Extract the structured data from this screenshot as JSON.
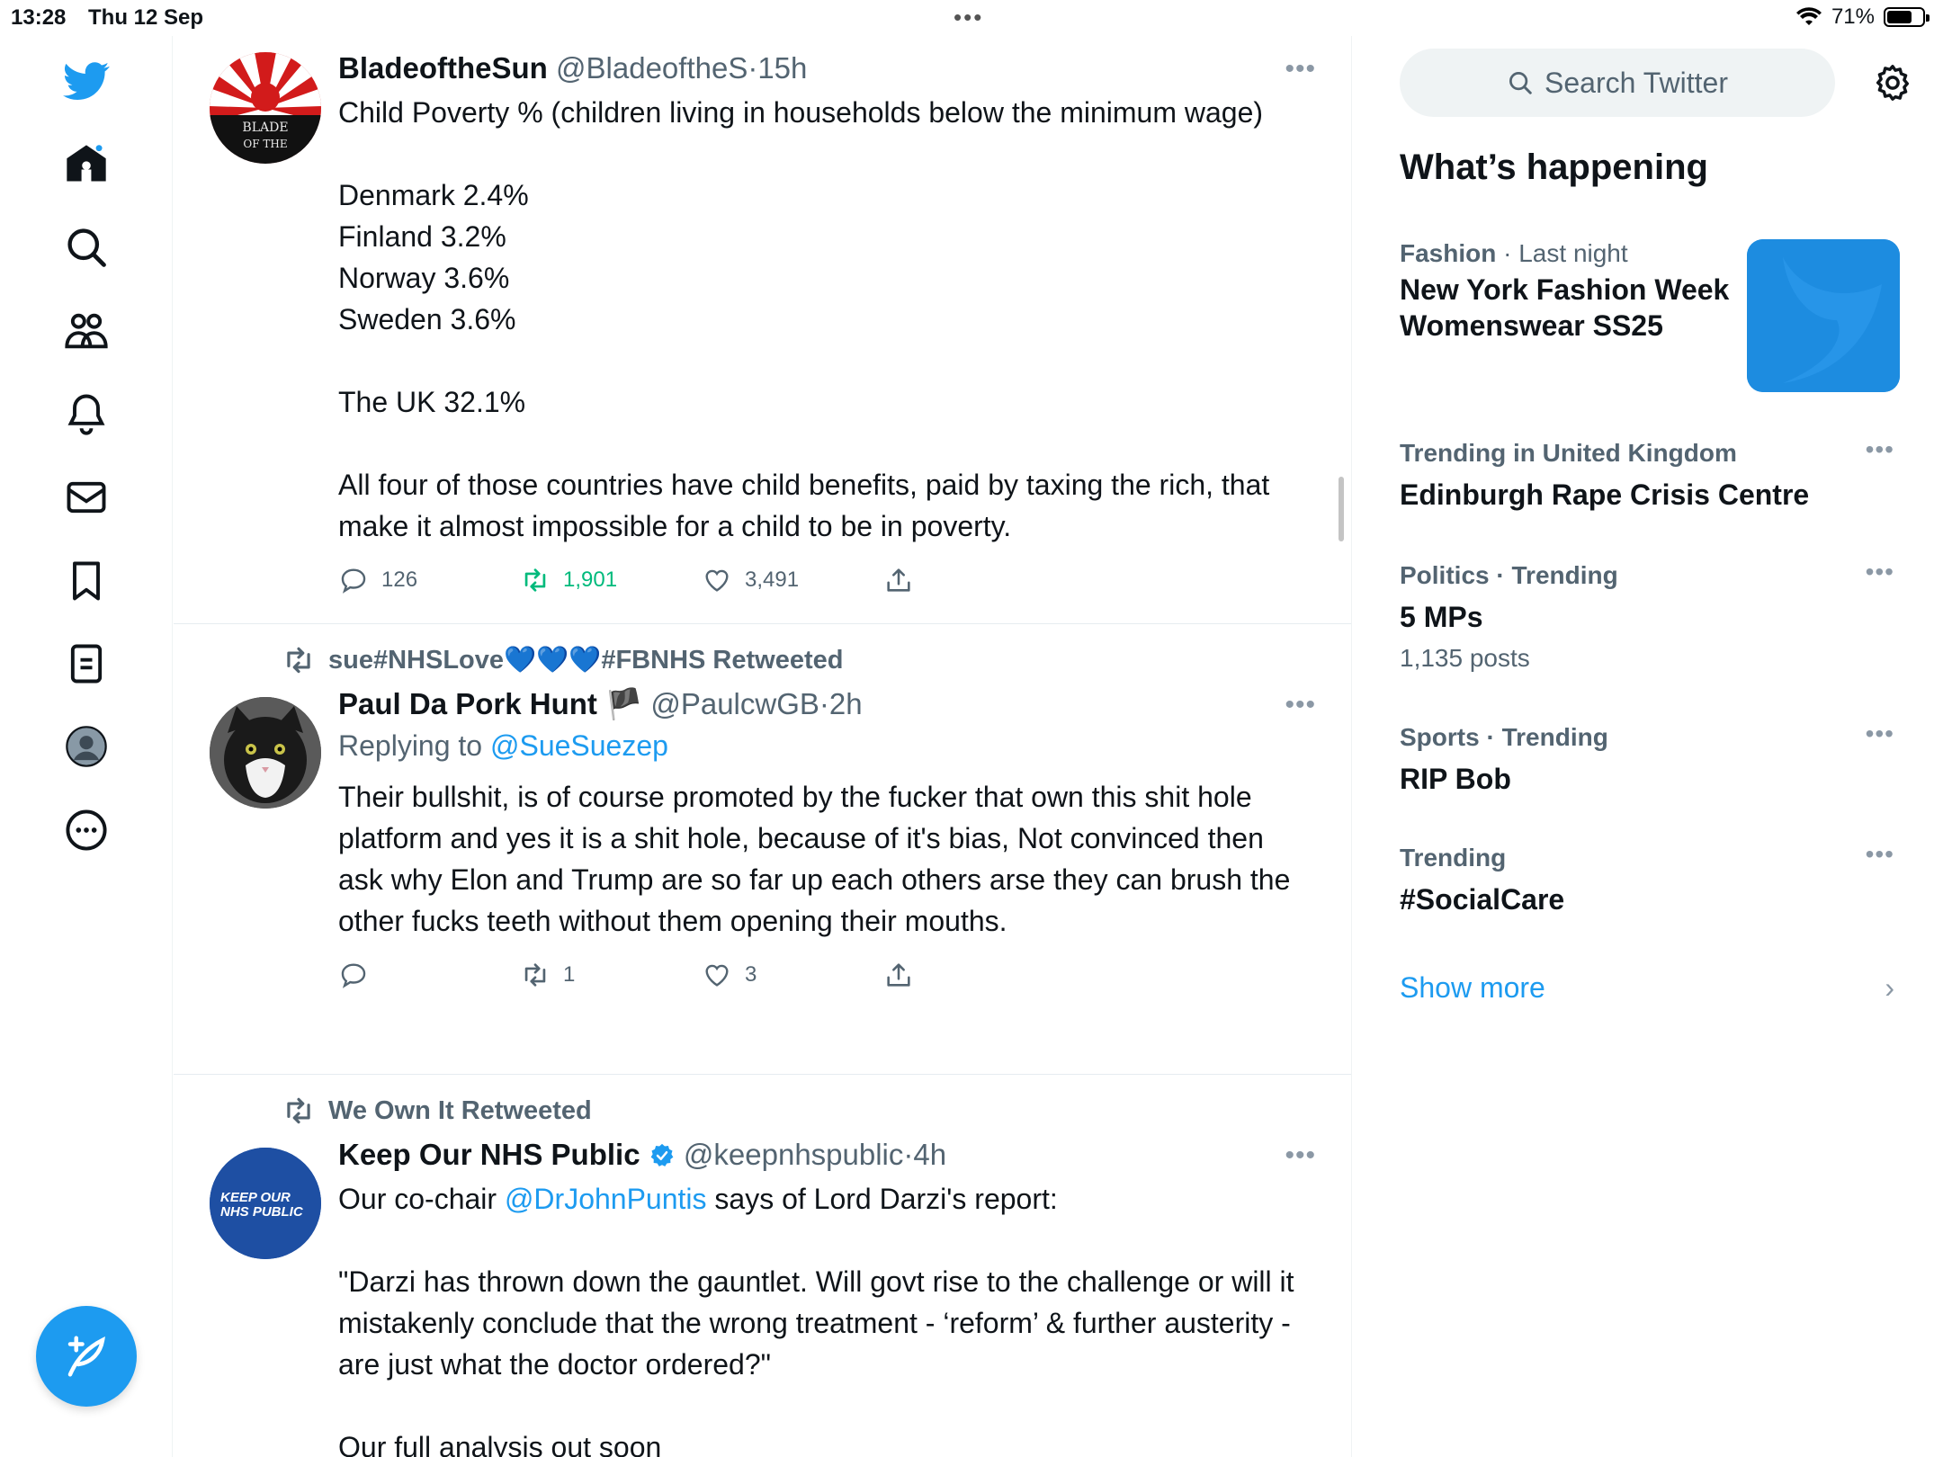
{
  "status_bar": {
    "time": "13:28",
    "date": "Thu 12 Sep",
    "battery": "71%",
    "battery_level": 0.71
  },
  "nav": {
    "items": [
      "twitter-logo",
      "home",
      "explore",
      "communities",
      "notifications",
      "messages",
      "bookmarks",
      "lists",
      "profile",
      "more"
    ]
  },
  "timeline": {
    "tweets": [
      {
        "name": "BladeoftheSun",
        "handle": "@BladeoftheS",
        "sep": "·",
        "time": "15h",
        "avatar_text": "BLADE\nOF THE",
        "text": "Child Poverty % (children living in households below the minimum wage)\n\nDenmark 2.4%\nFinland 3.2%\nNorway 3.6%\nSweden 3.6%\n\nThe UK 32.1%\n\nAll four of those countries have child benefits, paid by taxing the rich, that make it almost impossible for a child to be in poverty.",
        "replies": "126",
        "retweets": "1,901",
        "likes": "3,491"
      },
      {
        "retweeted_by": "sue#NHSLove💙💙💙#FBNHS Retweeted",
        "name": "Paul Da Pork Hunt",
        "flag": "🏴",
        "handle": "@PaulcwGB",
        "sep": "·",
        "time": "2h",
        "replying_prefix": "Replying to",
        "replying_to": "@SueSuezep",
        "text": "Their bullshit, is of course promoted by the fucker that own this shit hole platform and yes it is a shit hole, because of it's bias, Not convinced then ask why Elon and Trump are so far up each others arse they can brush the other fucks teeth without them opening their mouths.",
        "replies": "",
        "retweets": "1",
        "likes": "3"
      },
      {
        "retweeted_by": "We Own It Retweeted",
        "name": "Keep Our NHS Public",
        "handle": "@keepnhspublic",
        "sep": "·",
        "time": "4h",
        "avatar_text": "KEEP OUR\nNHS PUBLIC",
        "text_before": "Our co-chair ",
        "mention": "@DrJohnPuntis",
        "text_after": " says of Lord Darzi's report:\n\n\"Darzi has thrown down the gauntlet. Will govt rise to the challenge or will it mistakenly conclude that the wrong treatment - ‘reform’ & further austerity - are just what the doctor ordered?\"\n\nOur full analysis out soon"
      }
    ]
  },
  "sidebar": {
    "search_placeholder": "Search Twitter",
    "whats_happening": "What’s happening",
    "trends": [
      {
        "category": "Fashion",
        "sep": "·",
        "context": "Last night",
        "title": "New York Fashion Week Womenswear SS25"
      },
      {
        "category": "Trending in United Kingdom",
        "title": "Edinburgh Rape Crisis Centre"
      },
      {
        "category": "Politics",
        "sep": "·",
        "context": "Trending",
        "title": "5 MPs",
        "count": "1,135 posts"
      },
      {
        "category": "Sports",
        "sep": "·",
        "context": "Trending",
        "title": "RIP Bob"
      },
      {
        "category": "Trending",
        "title": "#SocialCare"
      }
    ],
    "show_more": "Show more"
  },
  "colors": {
    "accent": "#1d9bf0",
    "retweet_green": "#00ba7c",
    "secondary_text": "#536471"
  }
}
